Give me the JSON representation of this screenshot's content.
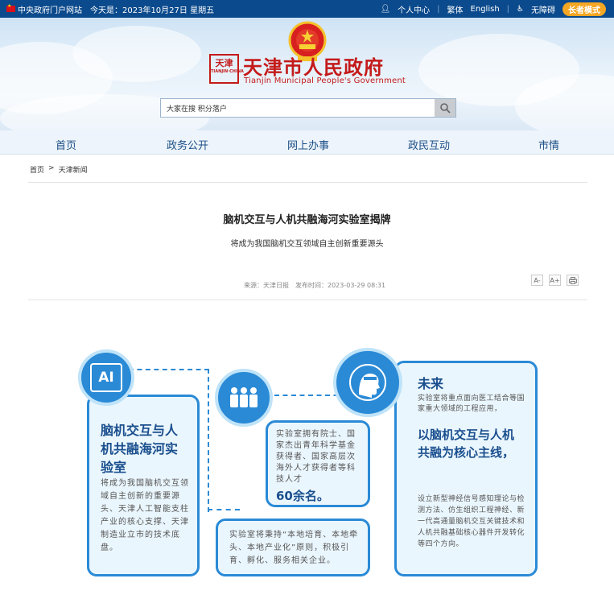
{
  "topbar": {
    "portal": "中央政府门户网站",
    "date": "今天是：2023年10月27日 星期五",
    "personal": "个人中心",
    "traditional": "繁体",
    "english": "English",
    "accessible": "无障碍",
    "elder_mode": "长者模式"
  },
  "header": {
    "seal_text": "天津",
    "seal_small": "TIANJIN·CHINA",
    "title": "天津市人民政府",
    "subtitle": "Tianjin Municipal People's Government"
  },
  "search": {
    "value": "大家在搜 积分落户"
  },
  "nav": {
    "items": [
      "首页",
      "政务公开",
      "网上办事",
      "政民互动",
      "市情"
    ]
  },
  "breadcrumb": {
    "home": "首页",
    "arrow": ">",
    "current": "天津新闻"
  },
  "article": {
    "title": "脑机交互与人机共融海河实验室揭牌",
    "subtitle": "将成为我国脑机交互领域自主创新重要源头",
    "source": "来源：天津日报",
    "time": "发布时间：2023-03-29 08:31",
    "tools": [
      "A-",
      "A+",
      "print"
    ]
  },
  "infographic": {
    "ai_label": "AI",
    "box1_title": "脑机交互与人机共融海河实验室",
    "box1_text": "将成为我国脑机交互领域自主创新的重要源头、天津人工智能支柱产业的核心支撑、天津制造业立市的技术底盘。",
    "box2_text": "实验室拥有院士、国家杰出青年科学基金获得者、国家高层次海外人才获得者等科技人才",
    "box2_count": "60余名。",
    "box3_text": "实验室将秉持“本地培育、本地牵头、本地产业化”原则，积极引育、孵化、服务相关企业。",
    "box4_title": "未来",
    "box4_text1": "实验室将重点面向医工结合等国家重大领域的工程应用，",
    "box4_highlight": "以脑机交互与人机共融为核心主线，",
    "box4_text2": "设立新型神经信号感知理论与检测方法、仿生组织工程神经、新一代高通量脑机交互关键技术和人机共融基础核心器件开发转化等四个方向。"
  }
}
